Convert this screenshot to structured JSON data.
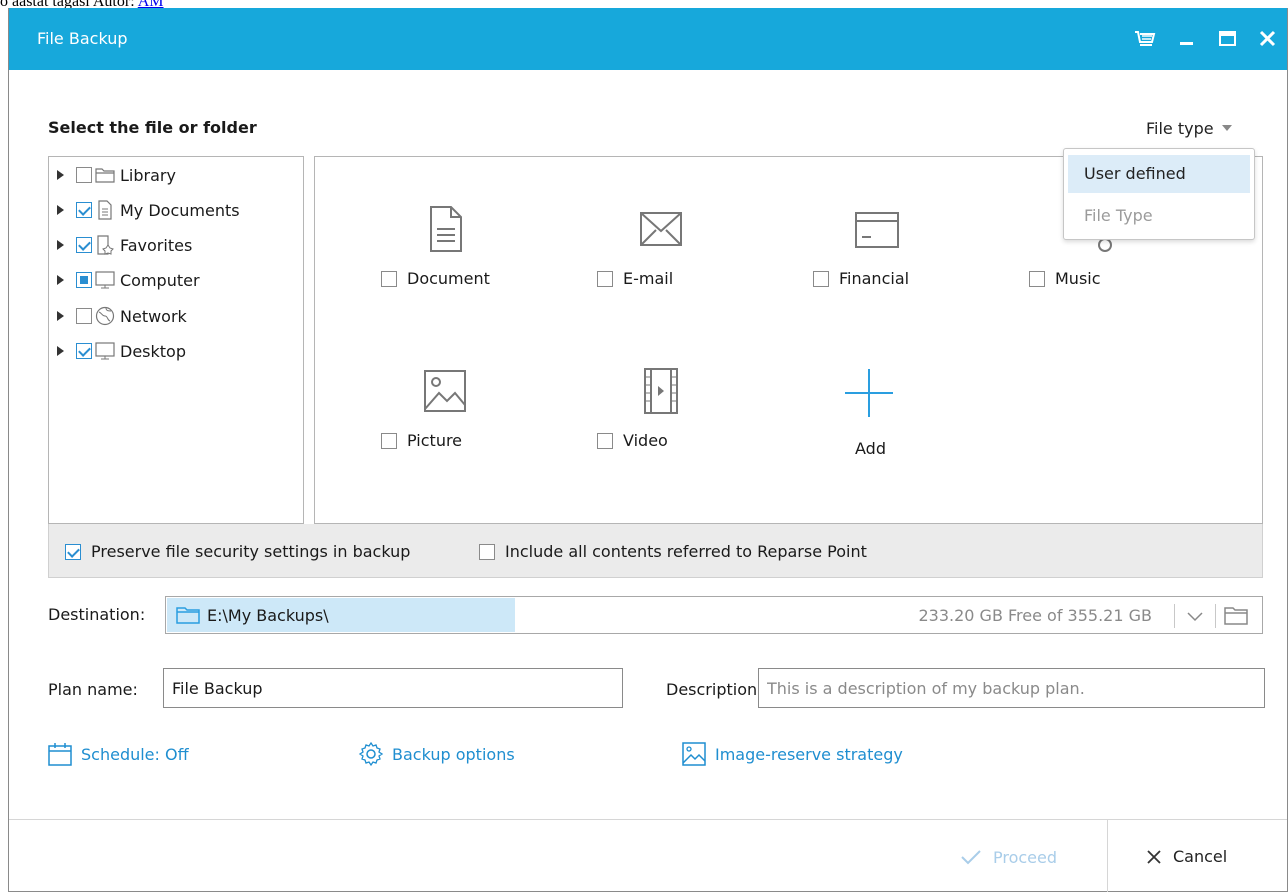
{
  "caption": {
    "text": "o aastat tagasi Autor: ",
    "link": "AM"
  },
  "window": {
    "title": "File Backup",
    "controls": {
      "cart": "cart-icon",
      "minimize": "minimize-icon",
      "maximize": "maximize-icon",
      "close": "close-icon"
    },
    "accent_color": "#17a8db"
  },
  "section": {
    "title": "Select the file or folder",
    "file_type_label": "File type"
  },
  "tree": [
    {
      "label": "Library",
      "state": "unchecked",
      "icon": "folder-icon"
    },
    {
      "label": "My Documents",
      "state": "checked",
      "icon": "document-icon"
    },
    {
      "label": "Favorites",
      "state": "checked",
      "icon": "favorites-icon"
    },
    {
      "label": "Computer",
      "state": "partial",
      "icon": "computer-icon"
    },
    {
      "label": "Network",
      "state": "unchecked",
      "icon": "network-icon"
    },
    {
      "label": "Desktop",
      "state": "checked",
      "icon": "monitor-icon"
    }
  ],
  "file_types": [
    {
      "label": "Document",
      "icon": "document-icon",
      "checked": false
    },
    {
      "label": "E-mail",
      "icon": "email-icon",
      "checked": false
    },
    {
      "label": "Financial",
      "icon": "financial-icon",
      "checked": false
    },
    {
      "label": "Music",
      "icon": "music-icon",
      "checked": false
    },
    {
      "label": "Picture",
      "icon": "picture-icon",
      "checked": false
    },
    {
      "label": "Video",
      "icon": "video-icon",
      "checked": false
    }
  ],
  "add_label": "Add",
  "dropdown": {
    "options": [
      {
        "label": "User defined"
      },
      {
        "label": "File Type"
      }
    ]
  },
  "options": {
    "preserve_security": {
      "label": "Preserve file security settings in backup",
      "checked": true
    },
    "reparse_point": {
      "label": "Include all contents referred to Reparse Point",
      "checked": false
    }
  },
  "destination": {
    "label": "Destination:",
    "path": "E:\\My Backups\\",
    "free_space": "233.20 GB Free of 355.21 GB"
  },
  "plan": {
    "label": "Plan name:",
    "value": "File Backup"
  },
  "description": {
    "label": "Description:",
    "placeholder": "This is a description of my backup plan."
  },
  "links": {
    "schedule": "Schedule: Off",
    "backup_options": "Backup options",
    "image_reserve": "Image-reserve strategy"
  },
  "footer": {
    "proceed": "Proceed",
    "cancel": "Cancel"
  }
}
